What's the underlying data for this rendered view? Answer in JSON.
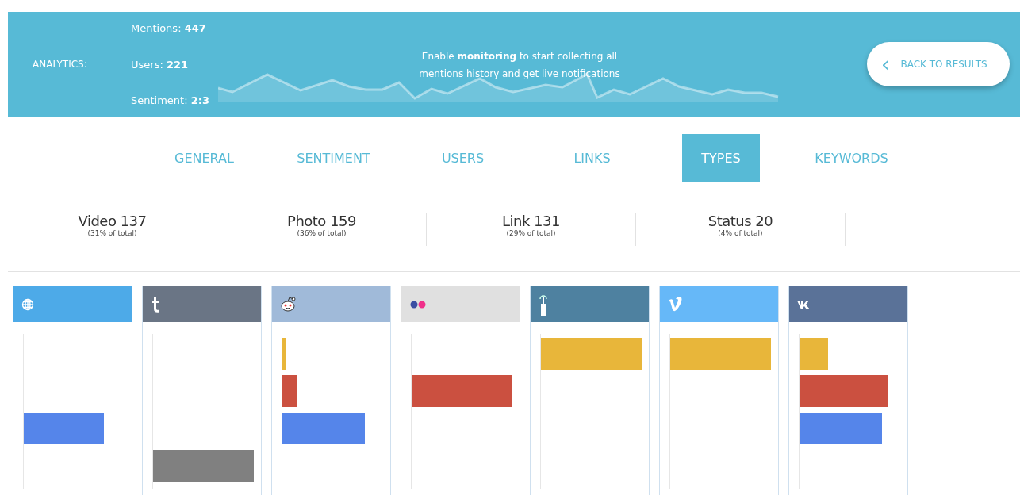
{
  "header": {
    "label": "ANALYTICS:",
    "stats": [
      {
        "label": "Mentions: ",
        "value": "447"
      },
      {
        "label": "Users: ",
        "value": "221"
      },
      {
        "label": "Sentiment: ",
        "value": "2:3"
      }
    ],
    "notice": "Enable **monitoring** to start collecting all mentions history and get live notifications",
    "back_button": {
      "icon": "‹",
      "label": "BACK TO RESULTS"
    }
  },
  "tabs": [
    {
      "label": "GENERAL",
      "selected": false
    },
    {
      "label": "SENTIMENT",
      "selected": false
    },
    {
      "label": "USERS",
      "selected": false
    },
    {
      "label": "LINKS",
      "selected": false
    },
    {
      "label": "TYPES",
      "selected": true
    },
    {
      "label": "KEYWORDS",
      "selected": false
    }
  ],
  "summary": [
    {
      "title": "Video 137",
      "share": "(31% of total)"
    },
    {
      "title": "Photo 159",
      "share": "(36% of total)"
    },
    {
      "title": "Link 131",
      "share": "(29% of total)"
    },
    {
      "title": "Status 20",
      "share": "(4% of total)"
    }
  ],
  "cards": [
    {
      "kind": "globe",
      "color": "#4daae8"
    },
    {
      "kind": "tumblr",
      "color": "#6a7585"
    },
    {
      "kind": "reddit",
      "color": "#a0bad9"
    },
    {
      "kind": "flickr",
      "color": "#e0e0e0"
    },
    {
      "kind": "ask",
      "color": "#4e81a0"
    },
    {
      "kind": "vimeo",
      "color": "#66b8f8"
    },
    {
      "kind": "vk",
      "color": "#5a7298"
    }
  ]
}
